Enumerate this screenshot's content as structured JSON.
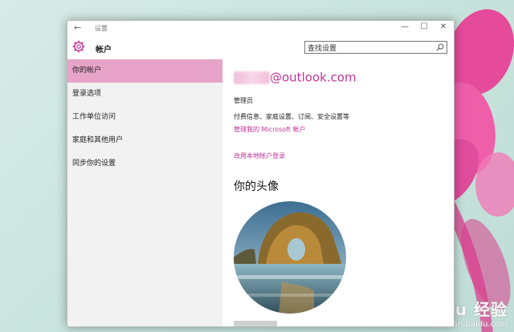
{
  "window": {
    "title": "设置",
    "back_glyph": "←",
    "controls": {
      "minimize": "—",
      "maximize": "☐",
      "close": "✕"
    }
  },
  "header": {
    "title": "帐户",
    "icon": "gear-icon",
    "search": {
      "value": "查找设置",
      "icon": "search-icon"
    }
  },
  "sidebar": {
    "items": [
      {
        "label": "你的帐户",
        "active": true
      },
      {
        "label": "登录选项",
        "active": false
      },
      {
        "label": "工作单位访问",
        "active": false
      },
      {
        "label": "家庭和其他用户",
        "active": false
      },
      {
        "label": "同步你的设置",
        "active": false
      }
    ]
  },
  "main": {
    "email_domain": "@outlook.com",
    "role": "管理员",
    "description": "付费信息、家庭设置、订阅、安全设置等",
    "manage_link": "管理我的 Microsoft 帐户",
    "local_link": "改用本地帐户登录",
    "avatar_heading": "你的头像"
  },
  "watermark": {
    "main": "Baidu 经验",
    "sub": "jingyan.baidu.com"
  },
  "colors": {
    "accent": "#c2339a",
    "active_nav": "#e8a4c8",
    "sidebar_bg": "#f2f2f2"
  }
}
